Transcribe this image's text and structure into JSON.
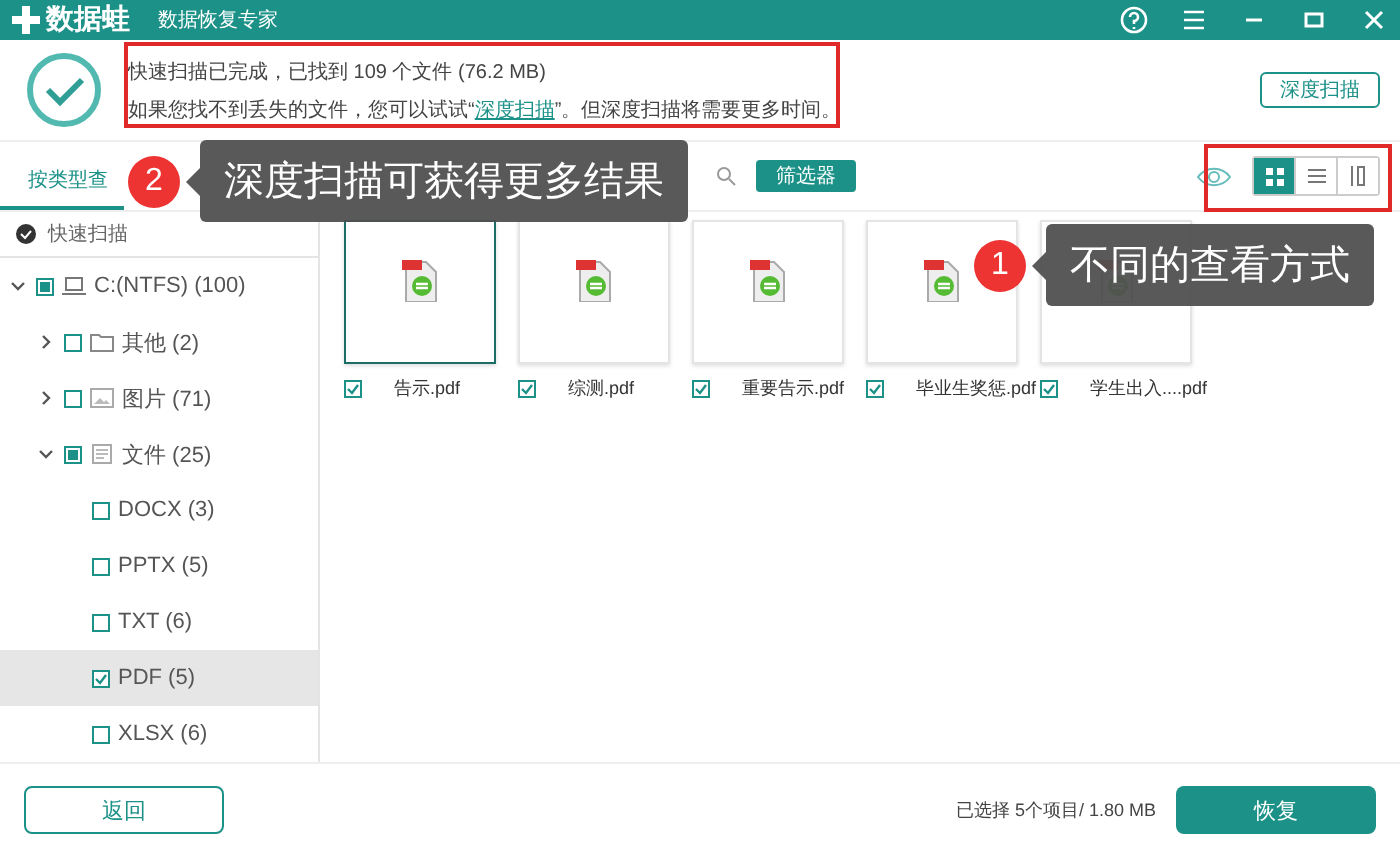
{
  "title_bar": {
    "app_name": "数据蛙",
    "subtitle": "数据恢复专家"
  },
  "scan_result": {
    "line1": "快速扫描已完成，已找到 109 个文件 (76.2 MB)",
    "line2_before": "如果您找不到丢失的文件，您可以试试“",
    "line2_link": "深度扫描",
    "line2_after": "”。但深度扫描将需要更多时间。",
    "deep_scan_button": "深度扫描"
  },
  "sidebar": {
    "tabs": [
      {
        "label": "按类型查",
        "selected": true
      }
    ],
    "scan_mode": "快速扫描",
    "tree": [
      {
        "label": "C:(NTFS) (100)",
        "kind": "drive",
        "checked": false,
        "partial": true,
        "expanded": true,
        "selected": false,
        "children": [
          {
            "label": "其他 (2)",
            "kind": "folder",
            "checked": false,
            "partial": false,
            "expanded": false,
            "selected": false
          },
          {
            "label": "图片 (71)",
            "kind": "image",
            "checked": false,
            "partial": false,
            "expanded": false,
            "selected": false
          },
          {
            "label": "文件 (25)",
            "kind": "document",
            "checked": false,
            "partial": true,
            "expanded": true,
            "selected": false,
            "children": [
              {
                "label": "DOCX (3)",
                "checked": false,
                "partial": false,
                "selected": false
              },
              {
                "label": "PPTX (5)",
                "checked": false,
                "partial": false,
                "selected": false
              },
              {
                "label": "TXT (6)",
                "checked": false,
                "partial": false,
                "selected": false
              },
              {
                "label": "PDF (5)",
                "checked": true,
                "partial": false,
                "selected": true
              },
              {
                "label": "XLSX (6)",
                "checked": false,
                "partial": false,
                "selected": false
              }
            ]
          }
        ]
      }
    ]
  },
  "toolbar": {
    "filter_button": "筛选器",
    "views": [
      {
        "kind": "grid",
        "selected": true
      },
      {
        "kind": "list",
        "selected": false
      },
      {
        "kind": "detail",
        "selected": false
      }
    ]
  },
  "files": [
    {
      "name": "告示.pdf",
      "checked": true,
      "selected": true
    },
    {
      "name": "综测.pdf",
      "checked": true,
      "selected": false
    },
    {
      "name": "重要告示.pdf",
      "checked": true,
      "selected": false
    },
    {
      "name": "毕业生奖惩.pdf",
      "checked": true,
      "selected": false
    },
    {
      "name": "学生出入....pdf",
      "checked": true,
      "selected": false
    }
  ],
  "footer": {
    "back_button": "返回",
    "status": "已选择 5个项目/ 1.80 MB",
    "recover_button": "恢复"
  },
  "callouts": [
    {
      "number": "2",
      "text": "深度扫描可获得更多结果"
    },
    {
      "number": "1",
      "text": "不同的查看方式"
    }
  ]
}
